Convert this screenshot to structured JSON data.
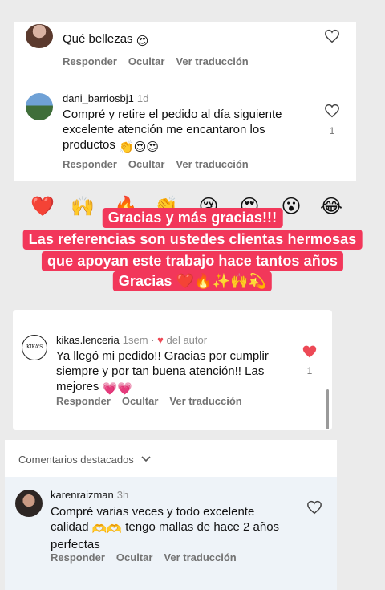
{
  "comments": [
    {
      "username": "",
      "time": "",
      "text": "Qué bellezas",
      "likes": "",
      "actions": [
        "Responder",
        "Ocultar",
        "Ver traducción"
      ]
    },
    {
      "username": "dani_barriosbj1",
      "time": "1d",
      "text": "Compré y retire el pedido al día siguiente excelente atención me encantaron los productos",
      "likes": "1",
      "actions": [
        "Responder",
        "Ocultar",
        "Ver traducción"
      ]
    },
    {
      "username": "kikas.lenceria",
      "time": "1sem",
      "author_tag": "del autor",
      "avatar_text": "KIKA'S",
      "text": "Ya llegó mi pedido!! Gracias por cumplir siempre y por tan buena atención!! Las mejores",
      "likes": "1",
      "actions": [
        "Responder",
        "Ocultar",
        "Ver traducción"
      ]
    },
    {
      "username": "karenraizman",
      "time": "3h",
      "text": "Compré varias veces y todo excelente calidad",
      "text_after": "tengo mallas de hace 2 años perfectas",
      "likes": "",
      "actions": [
        "Responder",
        "Ocultar",
        "Ver traducción"
      ]
    }
  ],
  "featured_label": "Comentarios destacados",
  "banner": {
    "line1": "Gracias y más gracias!!!",
    "line2": "Las referencias son ustedes clientas hermosas",
    "line3": "que apoyan este trabajo hace tantos años",
    "line4": "Gracias"
  },
  "reactions": [
    "❤️",
    "🙌",
    "🔥",
    "👏",
    "😢",
    "😍",
    "😮",
    "😂"
  ],
  "colors": {
    "accent_red": "#f2375a",
    "like_red": "#ed4956",
    "secondary_text": "#737373",
    "card_bg": "#ffffff",
    "featured_bg": "#eef3f8"
  }
}
